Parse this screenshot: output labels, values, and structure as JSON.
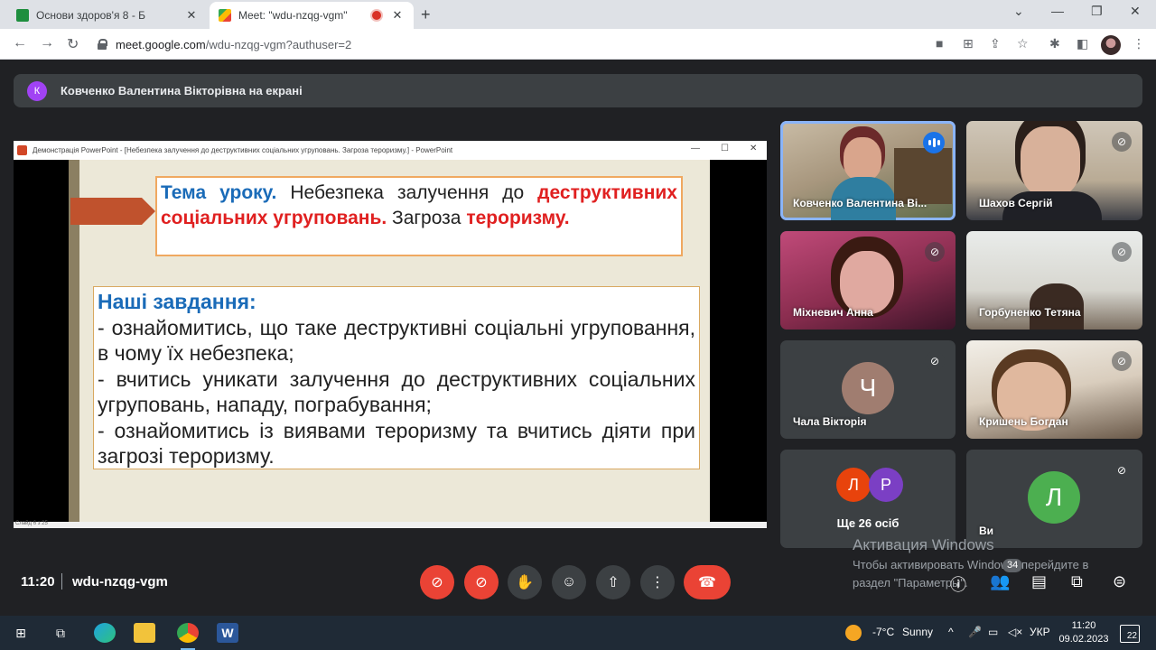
{
  "browser": {
    "tabs": [
      {
        "title": "Основи здоров'я 8 - Б",
        "active": false
      },
      {
        "title": "Meet: \"wdu-nzqg-vgm\"",
        "active": true
      }
    ],
    "new_tab": "+",
    "url_host": "meet.google.com",
    "url_path": "/wdu-nzqg-vgm?authuser=2",
    "window_controls": {
      "dropdown": "⌄",
      "minimize": "—",
      "restore": "❐",
      "close": "✕"
    }
  },
  "meet": {
    "presenter_initial": "К",
    "presenting_text": "Ковченко Валентина Вікторівна на екрані",
    "time": "11:20",
    "meeting_code": "wdu-nzqg-vgm",
    "participants_count": "34",
    "tiles": [
      {
        "name": "Ковченко Валентина Ві...",
        "speaking": true
      },
      {
        "name": "Шахов Сергій",
        "muted": true
      },
      {
        "name": "Міхневич Анна",
        "muted": true
      },
      {
        "name": "Горбуненко Тетяна",
        "muted": true
      },
      {
        "name": "Чала Вікторія",
        "muted": true,
        "initial": "Ч"
      },
      {
        "name": "Кришень Богдан",
        "muted": true
      },
      {
        "name": "Ще 26 осіб",
        "initials": [
          "Л",
          "Р"
        ]
      },
      {
        "name": "Ви",
        "muted": true,
        "initial": "Л"
      }
    ]
  },
  "powerpoint": {
    "window_title": "Демонстрація PowerPoint - [Небезпека залучення до деструктивних соціальних угруповань. Загроза тероризму.] - PowerPoint",
    "status": "Слайд 6 з 25",
    "slide": {
      "topic_label": "Тема уроку.",
      "topic_text1": " Небезпека залучення до ",
      "topic_red1": "деструктивних соціальних угруповань.",
      "topic_text2": " Загроза ",
      "topic_red2": "тероризму.",
      "tasks_title": "Наші завдання:",
      "task1": "- ознайомитись, що таке деструктивні соціальні угруповання, в чому їх небезпека;",
      "task2": "- вчитись уникати залучення до деструктивних соціальних угруповань, нападу, пограбування;",
      "task3": "- ознайомитись із виявами тероризму та вчитись діяти при загрозі тероризму."
    }
  },
  "watermark": {
    "title": "Активация Windows",
    "line1": "Чтобы активировать Windows, перейдите в",
    "line2": "раздел \"Параметры\"."
  },
  "taskbar": {
    "weather_temp": "-7°C",
    "weather_desc": "Sunny",
    "language": "УКР",
    "time": "11:20",
    "date": "09.02.2023",
    "notifications": "22"
  },
  "colors": {
    "meet_bg": "#202124",
    "accent_blue": "#1a73e8",
    "danger_red": "#ea4335",
    "slide_blue": "#1a6bb8",
    "slide_red": "#e02020"
  }
}
